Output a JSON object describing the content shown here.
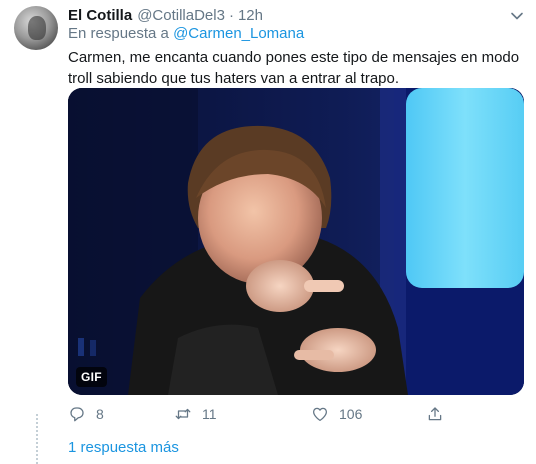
{
  "tweet": {
    "author_name": "El Cotilla",
    "author_handle": "@CotillaDel3",
    "separator": "·",
    "time": "12h",
    "reply_prefix": "En respuesta a ",
    "reply_mention": "@Carmen_Lomana",
    "text": "Carmen, me encanta cuando pones este tipo de mensajes en modo troll sabiendo que tus haters van a entrar al trapo.",
    "media_badge": "GIF"
  },
  "actions": {
    "replies": "8",
    "retweets": "11",
    "likes": "106"
  },
  "thread": {
    "more_replies": "1 respuesta más"
  },
  "colors": {
    "text": "#14171a",
    "secondary": "#657786",
    "link": "#1b95e0"
  }
}
